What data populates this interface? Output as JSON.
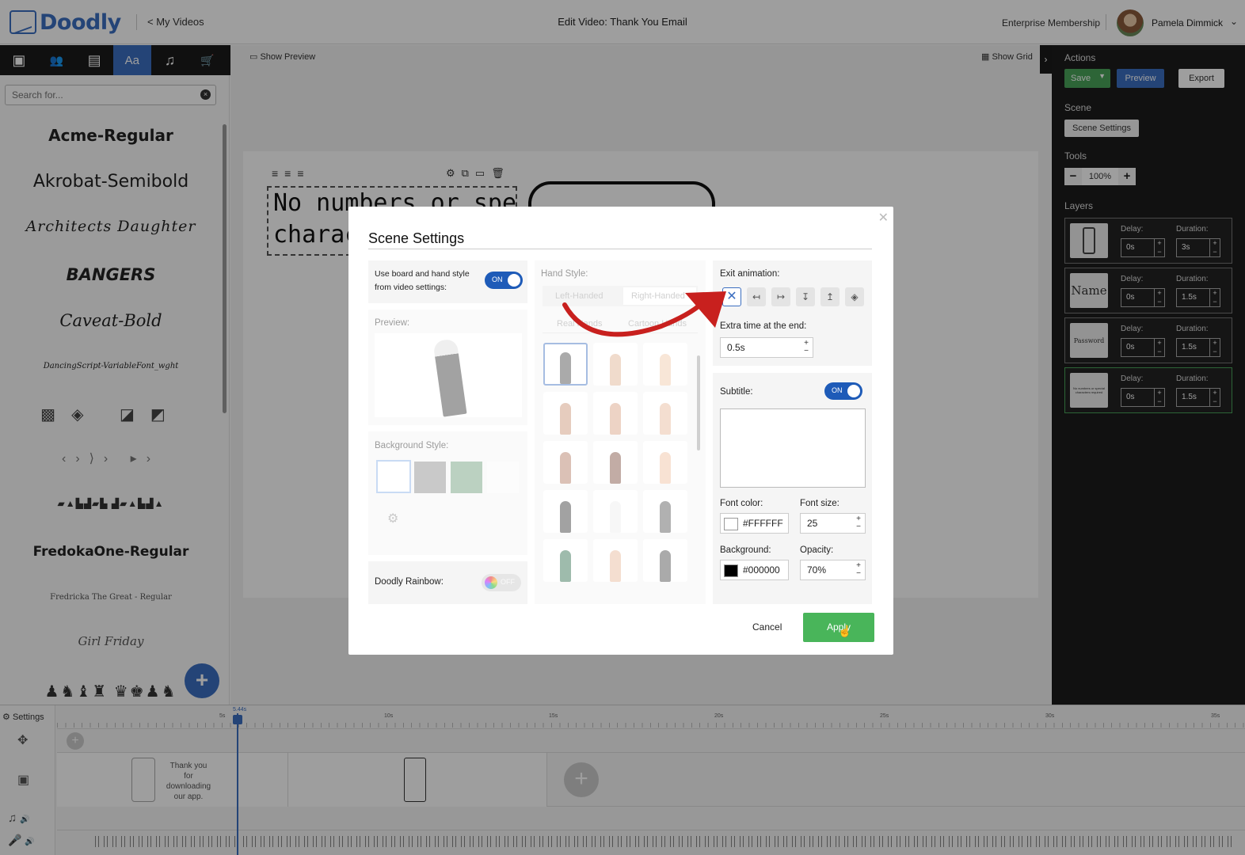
{
  "app": {
    "logo": "Doodly",
    "back_link": "< My Videos",
    "title": "Edit Video: Thank You Email",
    "membership": "Enterprise Membership",
    "user_name": "Pamela Dimmick"
  },
  "left_toolbar": {
    "tabs": [
      {
        "icon": "image-icon",
        "glyph": "▣"
      },
      {
        "icon": "characters-icon",
        "glyph": "👥"
      },
      {
        "icon": "props-icon",
        "glyph": "▤"
      },
      {
        "icon": "text-icon",
        "glyph": "Aa",
        "active": true
      },
      {
        "icon": "music-icon",
        "glyph": "♫"
      },
      {
        "icon": "cart-icon",
        "glyph": "🛒"
      }
    ],
    "collapse": "‹"
  },
  "font_panel": {
    "search_placeholder": "Search for...",
    "fonts": [
      "Acme-Regular",
      "Akrobat-Semibold",
      "Architects Daughter",
      "BANGERS",
      "Caveat-Bold",
      "DancingScript-VariableFont_wght",
      "FredokaOne-Regular",
      "Fredricka The Great - Regular",
      "Girl Friday"
    ]
  },
  "canvas": {
    "show_preview": "Show Preview",
    "show_grid": "Show Grid",
    "text_line1": "No numbers or special",
    "text_line2": "charact"
  },
  "right_panel": {
    "actions_heading": "Actions",
    "save_label": "Save",
    "preview_label": "Preview",
    "export_label": "Export",
    "scene_heading": "Scene",
    "scene_settings_label": "Scene Settings",
    "tools_heading": "Tools",
    "zoom_value": "100%",
    "layers_heading": "Layers",
    "delay_label": "Delay:",
    "duration_label": "Duration:",
    "layers": [
      {
        "thumb": "",
        "delay": "0s",
        "duration": "3s"
      },
      {
        "thumb": "Name",
        "delay": "0s",
        "duration": "1.5s"
      },
      {
        "thumb": "Password",
        "delay": "0s",
        "duration": "1.5s"
      },
      {
        "thumb": "No numbers or special characters required",
        "delay": "0s",
        "duration": "1.5s"
      }
    ]
  },
  "timeline": {
    "settings_label": "Settings",
    "playhead_time": "5.44s",
    "ticks": [
      "5s",
      "10s",
      "15s",
      "20s",
      "25s",
      "30s",
      "35s"
    ],
    "clip_text": "Thank you for downloading our app."
  },
  "modal": {
    "title": "Scene Settings",
    "use_board_label": "Use board and hand style from video settings:",
    "toggle_on": "ON",
    "preview_label": "Preview:",
    "background_style_label": "Background Style:",
    "doodly_rainbow_label": "Doodly Rainbow:",
    "toggle_off": "OFF",
    "hand_style_label": "Hand Style:",
    "left_handed": "Left-Handed",
    "right_handed": "Right-Handed",
    "real_hands": "Real Hands",
    "cartoon_hands": "Cartoon Hands",
    "exit_animation_label": "Exit animation:",
    "extra_time_label": "Extra time at the end:",
    "extra_time_value": "0.5s",
    "subtitle_label": "Subtitle:",
    "subtitle_value": "",
    "font_color_label": "Font color:",
    "font_color_value": "#FFFFFF",
    "font_size_label": "Font size:",
    "font_size_value": "25",
    "background_label": "Background:",
    "background_value": "#000000",
    "opacity_label": "Opacity:",
    "opacity_value": "70%",
    "cancel_label": "Cancel",
    "apply_label": "Apply"
  },
  "colors": {
    "brand_blue": "#3b6ec0",
    "save_green": "#49a35a",
    "apply_green": "#49b55a",
    "annotation_red": "#c8201e"
  }
}
